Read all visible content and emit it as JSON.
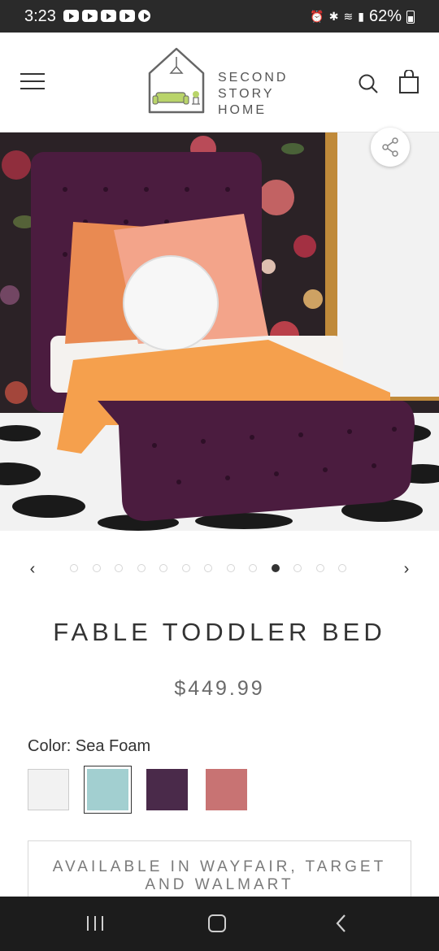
{
  "status_bar": {
    "time": "3:23",
    "battery": "62%"
  },
  "header": {
    "brand_line1": "SECOND",
    "brand_line2": "STORY",
    "brand_line3": "HOME"
  },
  "carousel": {
    "prev": "‹",
    "next": "›",
    "total": 13,
    "active_index": 9
  },
  "product": {
    "title": "FABLE TODDLER BED",
    "price": "$449.99",
    "color_label": "Color: Sea Foam",
    "swatches": [
      {
        "name": "White",
        "color": "#f2f2f2"
      },
      {
        "name": "Sea Foam",
        "color": "#a2cfd0",
        "selected": true
      },
      {
        "name": "Plum",
        "color": "#4a2a4a"
      },
      {
        "name": "Rose",
        "color": "#c87373"
      }
    ],
    "availability_line1": "AVAILABLE IN WAYFAIR, TARGET",
    "availability_line2": "AND WALMART"
  },
  "colors": {
    "accent_velvet": "#4b1c3f",
    "throw_orange": "#f5a04d"
  }
}
